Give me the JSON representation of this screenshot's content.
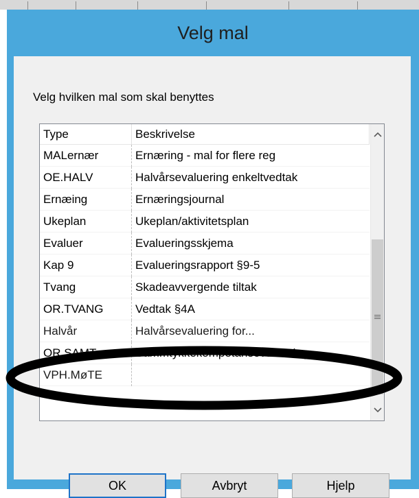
{
  "dialog": {
    "title": "Velg mal",
    "prompt": "Velg hvilken mal som skal benyttes"
  },
  "list": {
    "columns": [
      "Type",
      "Beskrivelse"
    ],
    "rows": [
      {
        "type": "MALernær",
        "description": "Ernæring - mal for flere reg"
      },
      {
        "type": "OE.HALV",
        "description": "Halvårsevaluering enkeltvedtak"
      },
      {
        "type": "Ernæing",
        "description": "Ernæringsjournal"
      },
      {
        "type": "Ukeplan",
        "description": "Ukeplan/aktivitetsplan"
      },
      {
        "type": "Evaluer",
        "description": "Evalueringsskjema"
      },
      {
        "type": "Kap 9",
        "description": "Evalueringsrapport §9-5"
      },
      {
        "type": "Tvang",
        "description": "Skadeavvergende tiltak"
      },
      {
        "type": "OR.TVANG",
        "description": "Vedtak §4A"
      },
      {
        "type": "Halvår",
        "description": "Halvårsevaluering for..."
      },
      {
        "type": "OR.SAMT",
        "description": "Sammtykkekompetansevurdering"
      },
      {
        "type": "VPH.MøTE",
        "description": ""
      }
    ]
  },
  "scrollbar": {
    "up_icon": "chevron-up-icon",
    "down_icon": "chevron-down-icon",
    "grip_icon": "grip-icon"
  },
  "buttons": {
    "ok": "OK",
    "cancel": "Avbryt",
    "help": "Hjelp"
  },
  "colors": {
    "title_bar": "#4aa8dc",
    "body": "#f0f0f0",
    "default_button_border": "#1d73c8",
    "annotation": "#000000"
  }
}
